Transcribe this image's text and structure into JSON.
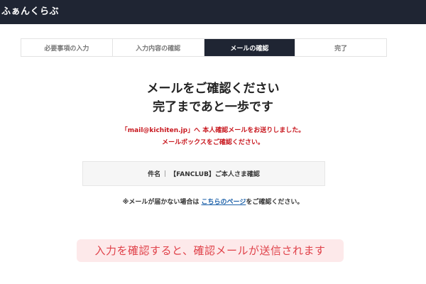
{
  "header": {
    "logo_text": "ふぁんくらぶ",
    "background": "#1f2533"
  },
  "steps": [
    {
      "label": "必要事項の入力",
      "active": false
    },
    {
      "label": "入力内容の確認",
      "active": false
    },
    {
      "label": "メールの確認",
      "active": true
    },
    {
      "label": "完了",
      "active": false
    }
  ],
  "main": {
    "heading_line1": "メールをご確認ください",
    "heading_line2": "完了まであと一歩です",
    "message_line1": "「mail@kichiten.jp」へ 本人確認メールをお送りしました。",
    "message_line2": "メールボックスをご確認ください。",
    "subject_label": "件名",
    "subject_separator": "|",
    "subject_value": "【FANCLUB】ご本人さま確認",
    "note_prefix": "※メールが届かない場合は ",
    "note_link": "こちらのページ",
    "note_suffix": "をご確認ください。"
  },
  "caption": {
    "text": "入力を確認すると、確認メールが送信されます"
  },
  "colors": {
    "accent_red": "#c8171e",
    "link_blue": "#1a5fa8",
    "caption_bg": "#fde9ea",
    "caption_text": "#e0424a"
  }
}
